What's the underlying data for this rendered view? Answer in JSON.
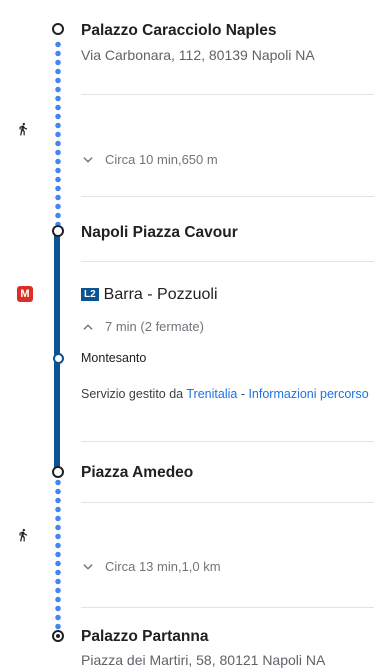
{
  "stops": {
    "origin": {
      "name": "Palazzo Caracciolo Naples",
      "address": "Via Carbonara, 112, 80139 Napoli NA"
    },
    "cavour": {
      "name": "Napoli Piazza Cavour"
    },
    "montesanto": {
      "name": "Montesanto"
    },
    "amedeo": {
      "name": "Piazza Amedeo"
    },
    "destination": {
      "name": "Palazzo Partanna",
      "address": "Piazza dei Martiri, 58, 80121 Napoli NA"
    }
  },
  "walk1": {
    "summary": "Circa 10 min,650 m",
    "icon": "walk-icon"
  },
  "transit": {
    "icon": "metro-icon",
    "icon_letter": "M",
    "line_code": "L2",
    "route_name": "Barra - Pozzuoli",
    "duration": "7 min (2 fermate)",
    "operator_prefix": "Servizio gestito da",
    "operator_name": "Trenitalia",
    "separator": " - ",
    "info_link": "Informazioni percorso",
    "line_color": "#0b5394",
    "icon_color": "#d93025"
  },
  "walk2": {
    "summary": "Circa 13 min,1,0 km",
    "icon": "walk-icon"
  },
  "colors": {
    "walk_dots": "#4285f4",
    "link": "#1a73e8"
  }
}
